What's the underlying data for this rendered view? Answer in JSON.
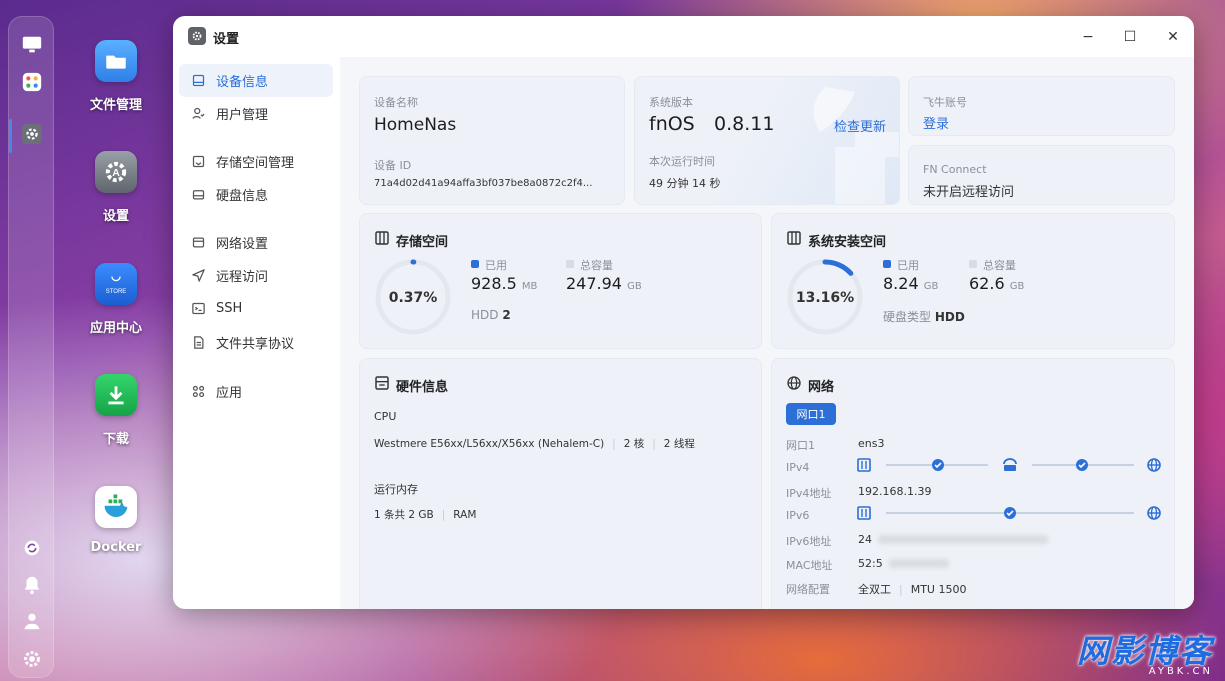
{
  "desktop": {
    "icons": [
      {
        "label": "文件管理",
        "icon": "folder-icon"
      },
      {
        "label": "设置",
        "icon": "gear-icon"
      },
      {
        "label": "应用中心",
        "icon": "store-icon",
        "badge": "STORE"
      },
      {
        "label": "下载",
        "icon": "download-icon"
      },
      {
        "label": "Docker",
        "icon": "docker-icon"
      }
    ]
  },
  "window": {
    "title": "设置",
    "controls": {
      "minimize": "−",
      "maximize": "☐",
      "close": "✕"
    }
  },
  "sidebar": {
    "items": [
      {
        "label": "设备信息",
        "icon": "device-info-icon",
        "active": true
      },
      {
        "label": "用户管理",
        "icon": "user-icon"
      },
      {
        "label": "存储空间管理",
        "icon": "storage-icon"
      },
      {
        "label": "硬盘信息",
        "icon": "disk-icon"
      },
      {
        "label": "网络设置",
        "icon": "network-icon"
      },
      {
        "label": "远程访问",
        "icon": "send-icon"
      },
      {
        "label": "SSH",
        "icon": "ssh-icon"
      },
      {
        "label": "文件共享协议",
        "icon": "file-share-icon"
      },
      {
        "label": "应用",
        "icon": "apps-icon"
      }
    ]
  },
  "device": {
    "name_label": "设备名称",
    "name": "HomeNas",
    "id_label": "设备 ID",
    "id": "71a4d02d41a94affa3bf037be8a0872c2f4..."
  },
  "system": {
    "version_label": "系统版本",
    "os": "fnOS",
    "version": "0.8.11",
    "check_update": "检查更新",
    "uptime_label": "本次运行时间",
    "uptime": "49 分钟 14 秒"
  },
  "account": {
    "label": "飞牛账号",
    "login": "登录"
  },
  "fn_connect": {
    "label": "FN Connect",
    "status": "未开启远程访问"
  },
  "storage": {
    "title": "存储空间",
    "percent_text": "0.37%",
    "percent": 0.37,
    "used_label": "已用",
    "used_value": "928.5",
    "used_unit": "MB",
    "total_label": "总容量",
    "total_value": "247.94",
    "total_unit": "GB",
    "disk_label": "HDD",
    "disk_count": "2"
  },
  "sys_space": {
    "title": "系统安装空间",
    "percent_text": "13.16%",
    "percent": 13.16,
    "used_label": "已用",
    "used_value": "8.24",
    "used_unit": "GB",
    "total_label": "总容量",
    "total_value": "62.6",
    "total_unit": "GB",
    "disk_type_label": "硬盘类型",
    "disk_type": "HDD"
  },
  "hardware": {
    "title": "硬件信息",
    "cpu_label": "CPU",
    "cpu_model": "Westmere E56xx/L56xx/X56xx (Nehalem-C)",
    "cpu_cores": "2 核",
    "cpu_threads": "2 线程",
    "mem_label": "运行内存",
    "mem_value": "1 条共 2 GB",
    "mem_type": "RAM"
  },
  "network": {
    "title": "网络",
    "port_tab": "网口1",
    "rows": {
      "port_key": "网口1",
      "port_val": "ens3",
      "ipv4_key": "IPv4",
      "ipv4_addr_key": "IPv4地址",
      "ipv4_addr_val": "192.168.1.39",
      "ipv6_key": "IPv6",
      "ipv6_addr_key": "IPv6地址",
      "ipv6_addr_val": "24",
      "mac_key": "MAC地址",
      "mac_val": "52:5",
      "config_key": "网络配置",
      "duplex": "全双工",
      "mtu": "MTU 1500"
    }
  },
  "watermark": {
    "main": "网影博客",
    "sub": "AYBK.CN"
  },
  "colors": {
    "accent": "#2c6fd6",
    "ring_track": "#e3e7ee",
    "ring_fill": "#2c6fd6"
  }
}
